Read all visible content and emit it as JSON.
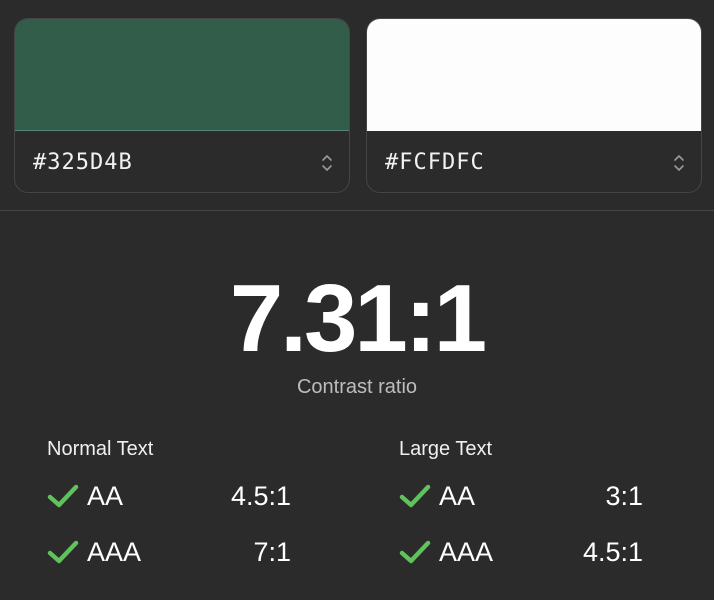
{
  "foreground": {
    "hex": "#325D4B",
    "color": "#325D4B"
  },
  "background": {
    "hex": "#FCFDFC",
    "color": "#FCFDFC"
  },
  "contrast": {
    "ratio": "7.31:1",
    "caption": "Contrast ratio"
  },
  "normal_text": {
    "title": "Normal Text",
    "rows": [
      {
        "level": "AA",
        "threshold": "4.5:1",
        "passed": true
      },
      {
        "level": "AAA",
        "threshold": "7:1",
        "passed": true
      }
    ]
  },
  "large_text": {
    "title": "Large Text",
    "rows": [
      {
        "level": "AA",
        "threshold": "3:1",
        "passed": true
      },
      {
        "level": "AAA",
        "threshold": "4.5:1",
        "passed": true
      }
    ]
  },
  "colors": {
    "pass_check": "#5fc25a",
    "app_background": "#2b2b2b"
  },
  "icons": {
    "stepper": "chevron-up-down-icon",
    "pass": "checkmark-icon"
  }
}
